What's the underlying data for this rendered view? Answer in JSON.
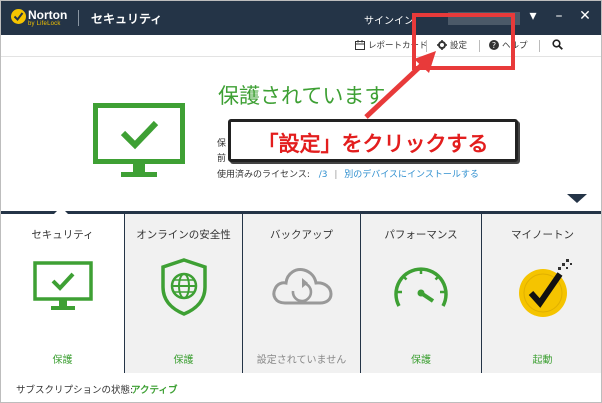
{
  "brand": {
    "logo_name": "Norton",
    "logo_sub": "by LifeLock",
    "accent": "#f5c400"
  },
  "window": {
    "title": "セキュリティ",
    "signin_label": "サインイン",
    "controls": [
      "▾",
      "–",
      "✕"
    ]
  },
  "toolbar": {
    "report_label": "レポートカード",
    "settings_label": "設定",
    "help_label": "ヘルプ",
    "search_icon": "search-icon"
  },
  "hero": {
    "status_title": "保護されています",
    "line1_prefix": "保",
    "line2_prefix": "前",
    "license_label": "使用済みのライセンス:",
    "license_count": "/3",
    "install_link": "別のデバイスにインストールする"
  },
  "annotation": {
    "callout_text": "「設定」をクリックする",
    "highlight_color": "#e83a3a"
  },
  "tabs": [
    {
      "label": "セキュリティ",
      "status": "保護",
      "icon": "monitor-check-icon",
      "active": true
    },
    {
      "label": "オンラインの安全性",
      "status": "保護",
      "icon": "shield-globe-icon",
      "active": false
    },
    {
      "label": "バックアップ",
      "status": "設定されていません",
      "icon": "cloud-backup-icon",
      "active": false
    },
    {
      "label": "パフォーマンス",
      "status": "保護",
      "icon": "gauge-icon",
      "active": false
    },
    {
      "label": "マイノートン",
      "status": "起動",
      "icon": "norton-badge-icon",
      "active": false
    }
  ],
  "footer": {
    "subscription_label": "サブスクリプションの状態:",
    "subscription_value": "アクティブ"
  },
  "colors": {
    "titlebar": "#243447",
    "status_green": "#3ea034",
    "link_blue": "#2f8fcf"
  }
}
